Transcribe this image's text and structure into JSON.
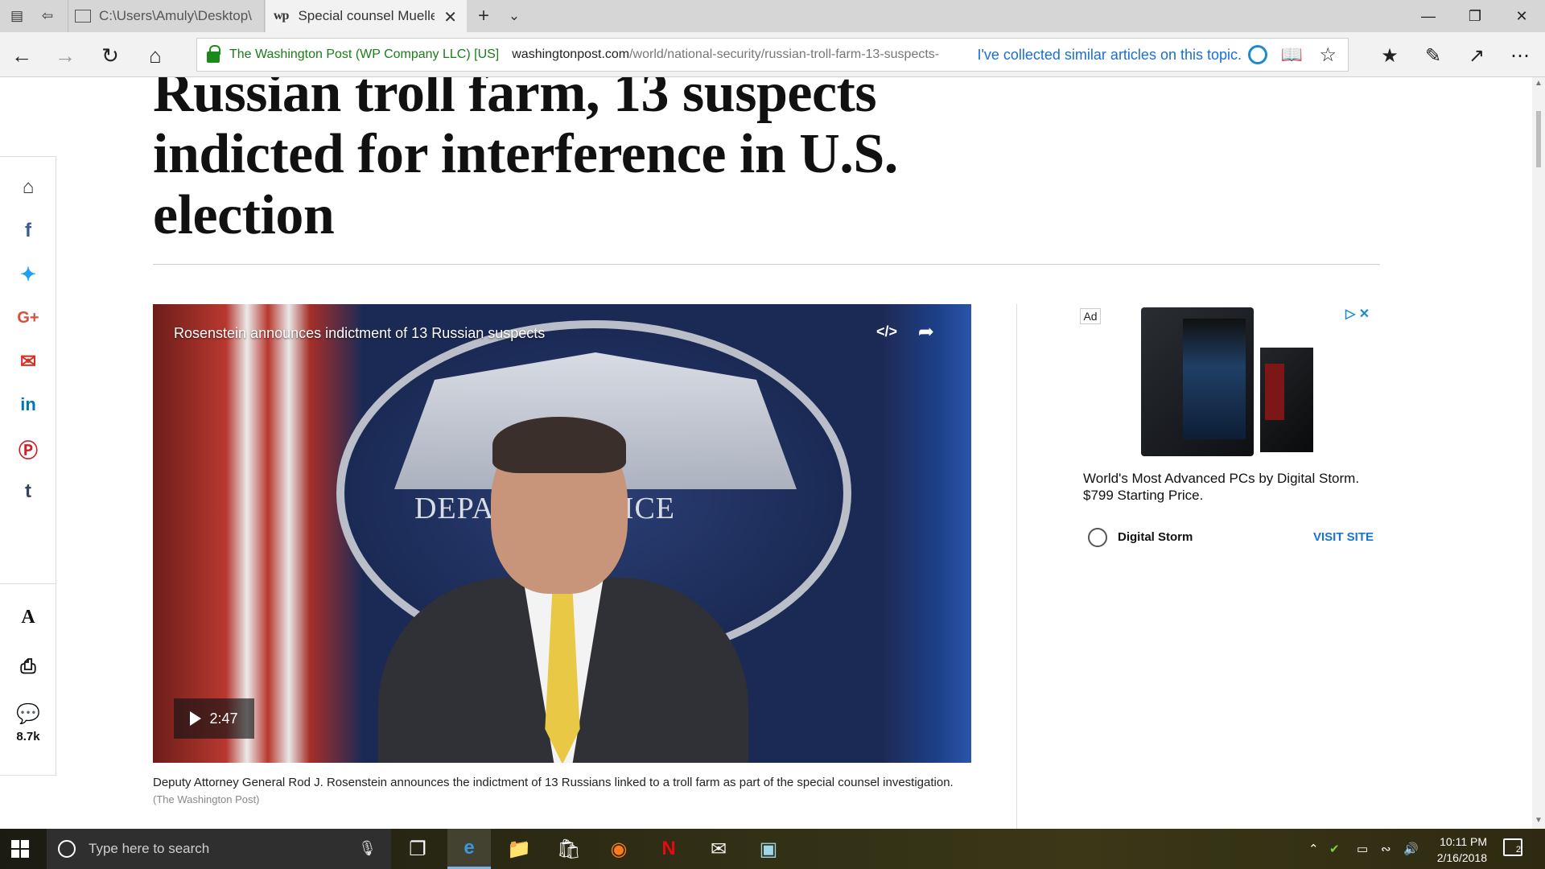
{
  "browser": {
    "tabs": [
      {
        "label": "C:\\Users\\Amuly\\Desktop\\lal",
        "active": false
      },
      {
        "label": "Special counsel Mueller",
        "favicon": "wp",
        "active": true
      }
    ],
    "cert_owner": "The Washington Post (WP Company LLC) [US]",
    "url_host": "washingtonpost.com",
    "url_path": "/world/national-security/russian-troll-farm-13-suspects-",
    "collected_text": "I've collected similar articles on this topic.",
    "icons": {
      "back": "back-arrow-icon",
      "forward": "forward-arrow-icon",
      "refresh": "refresh-icon",
      "home": "home-icon",
      "favorites": "favorites-icon",
      "pen": "pen-icon",
      "share": "share-icon",
      "more": "more-icon"
    }
  },
  "article": {
    "headline": "Russian troll farm, 13 suspects indicted for interference in U.S. election",
    "video": {
      "title": "Rosenstein announces indictment of 13 Russian suspects",
      "duration": "2:47",
      "backdrop_text": "DEPA        OF JUSTICE"
    },
    "caption": "Deputy Attorney General Rod J. Rosenstein announces the indictment of 13 Russians linked to a troll farm as part of the special counsel investigation.",
    "caption_credit": "(The Washington Post)"
  },
  "share_rail": {
    "items": [
      "home",
      "facebook",
      "twitter",
      "google-plus",
      "email",
      "linkedin",
      "pinterest",
      "tumblr",
      "text-size",
      "print",
      "comments"
    ],
    "comment_count": "8.7k"
  },
  "ad": {
    "label": "Ad",
    "text": "World's Most Advanced PCs by Digital Storm. $799 Starting Price.",
    "brand": "Digital Storm",
    "cta": "VISIT SITE"
  },
  "taskbar": {
    "search_placeholder": "Type here to search",
    "time": "10:11 PM",
    "date": "2/16/2018",
    "notification_count": "2"
  }
}
